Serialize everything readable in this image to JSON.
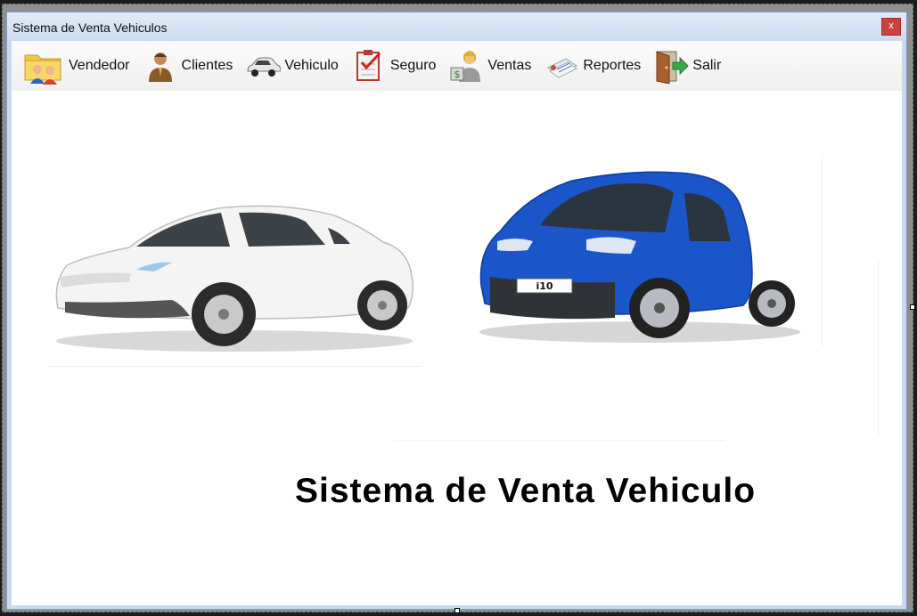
{
  "window": {
    "title": "Sistema de Venta Vehiculos",
    "close_label": "x"
  },
  "menu": {
    "items": [
      {
        "label": "Vendedor",
        "icon": "folder-users-icon"
      },
      {
        "label": "Clientes",
        "icon": "person-icon"
      },
      {
        "label": "Vehiculo",
        "icon": "car-icon"
      },
      {
        "label": "Seguro",
        "icon": "checklist-icon"
      },
      {
        "label": "Ventas",
        "icon": "sales-person-icon"
      },
      {
        "label": "Reportes",
        "icon": "reports-icon"
      },
      {
        "label": "Salir",
        "icon": "exit-door-icon"
      }
    ]
  },
  "main": {
    "heading": "Sistema de Venta Vehiculo",
    "car_left": "white-sedan-image",
    "car_right": "blue-hatchback-image",
    "car_right_badge": "i10"
  },
  "colors": {
    "close": "#c8433e",
    "titlebar": "#cddcf0",
    "car_blue": "#1a55c9"
  }
}
